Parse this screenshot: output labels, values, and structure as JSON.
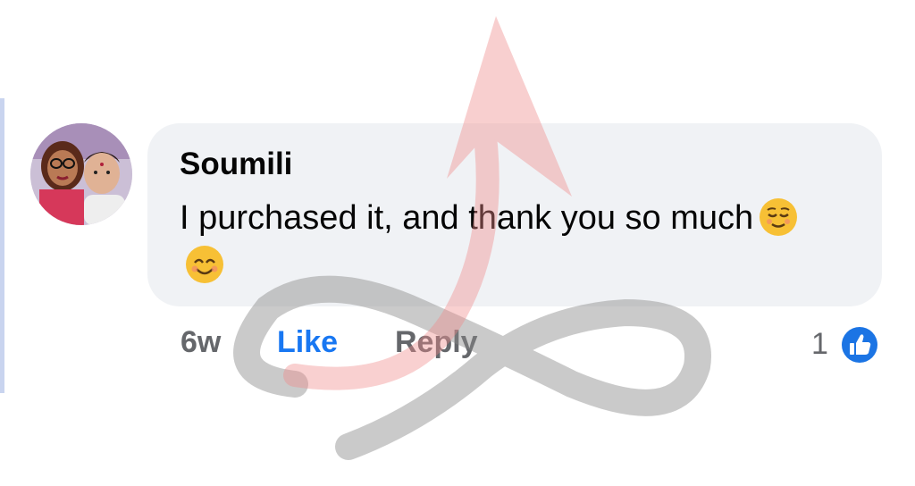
{
  "comment": {
    "author": "Soumili",
    "text": "I purchased it, and thank you so much",
    "emojis": [
      "relieved-face-emoji",
      "smiling-face-with-smiling-eyes-emoji"
    ]
  },
  "actions": {
    "time": "6w",
    "like_label": "Like",
    "reply_label": "Reply"
  },
  "reactions": {
    "count": "1",
    "icon": "thumbs-up-icon"
  },
  "colors": {
    "bubble": "#f0f2f5",
    "like_blue": "#1877f2",
    "muted_text": "#65676b",
    "thread_line": "#c9d4ef"
  }
}
